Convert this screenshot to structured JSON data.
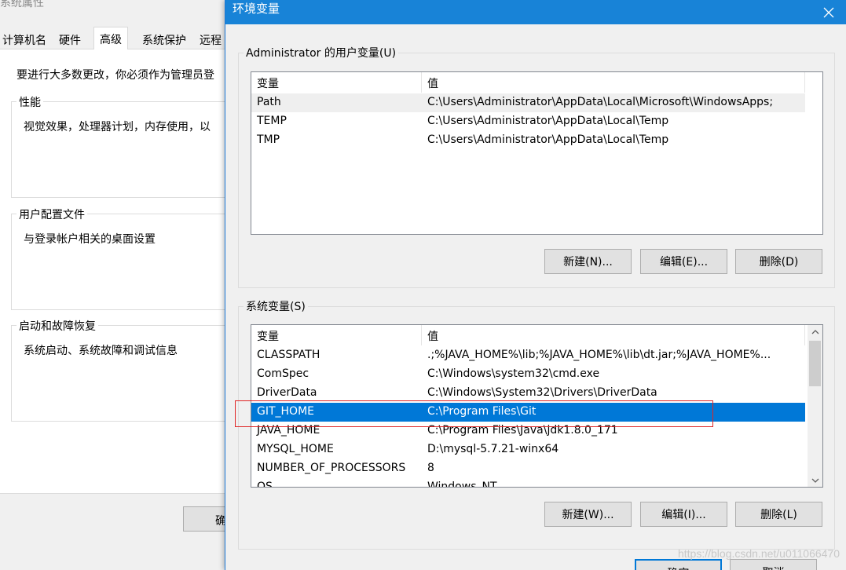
{
  "background_dialog": {
    "title": "系统属性",
    "tabs": [
      "计算机名",
      "硬件",
      "高级",
      "系统保护",
      "远程"
    ],
    "active_tab": "高级",
    "intro": "要进行大多数更改，你必须作为管理员登",
    "groups": [
      {
        "legend": "性能",
        "desc": "视觉效果，处理器计划，内存使用，以"
      },
      {
        "legend": "用户配置文件",
        "desc": "与登录帐户相关的桌面设置"
      },
      {
        "legend": "启动和故障恢复",
        "desc": "系统启动、系统故障和调试信息"
      }
    ],
    "ok_partial": "确"
  },
  "env_dialog": {
    "title": "环境变量",
    "close_icon": "close-icon",
    "user_vars": {
      "legend": "Administrator 的用户变量(U)",
      "columns": [
        "变量",
        "值"
      ],
      "rows": [
        {
          "name": "Path",
          "value": "C:\\Users\\Administrator\\AppData\\Local\\Microsoft\\WindowsApps;"
        },
        {
          "name": "TEMP",
          "value": "C:\\Users\\Administrator\\AppData\\Local\\Temp"
        },
        {
          "name": "TMP",
          "value": "C:\\Users\\Administrator\\AppData\\Local\\Temp"
        }
      ],
      "buttons": {
        "new": "新建(N)...",
        "edit": "编辑(E)...",
        "delete": "删除(D)"
      }
    },
    "system_vars": {
      "legend": "系统变量(S)",
      "columns": [
        "变量",
        "值"
      ],
      "rows": [
        {
          "name": "CLASSPATH",
          "value": ".;%JAVA_HOME%\\lib;%JAVA_HOME%\\lib\\dt.jar;%JAVA_HOME%..."
        },
        {
          "name": "ComSpec",
          "value": "C:\\Windows\\system32\\cmd.exe"
        },
        {
          "name": "DriverData",
          "value": "C:\\Windows\\System32\\Drivers\\DriverData"
        },
        {
          "name": "GIT_HOME",
          "value": "C:\\Program Files\\Git"
        },
        {
          "name": "JAVA_HOME",
          "value": "C:\\Program Files\\Java\\jdk1.8.0_171"
        },
        {
          "name": "MYSQL_HOME",
          "value": "D:\\mysql-5.7.21-winx64"
        },
        {
          "name": "NUMBER_OF_PROCESSORS",
          "value": "8"
        },
        {
          "name": "OS",
          "value": "Windows_NT"
        }
      ],
      "selected_row": "GIT_HOME",
      "buttons": {
        "new": "新建(W)...",
        "edit": "编辑(I)...",
        "delete": "删除(L)"
      }
    },
    "footer_buttons": {
      "ok": "确定",
      "cancel": "取消"
    }
  },
  "watermark": "https://blog.csdn.net/u011066470",
  "colors": {
    "titlebar": "#1883d7",
    "selection": "#0078d7",
    "highlight_box": "#e02424"
  }
}
